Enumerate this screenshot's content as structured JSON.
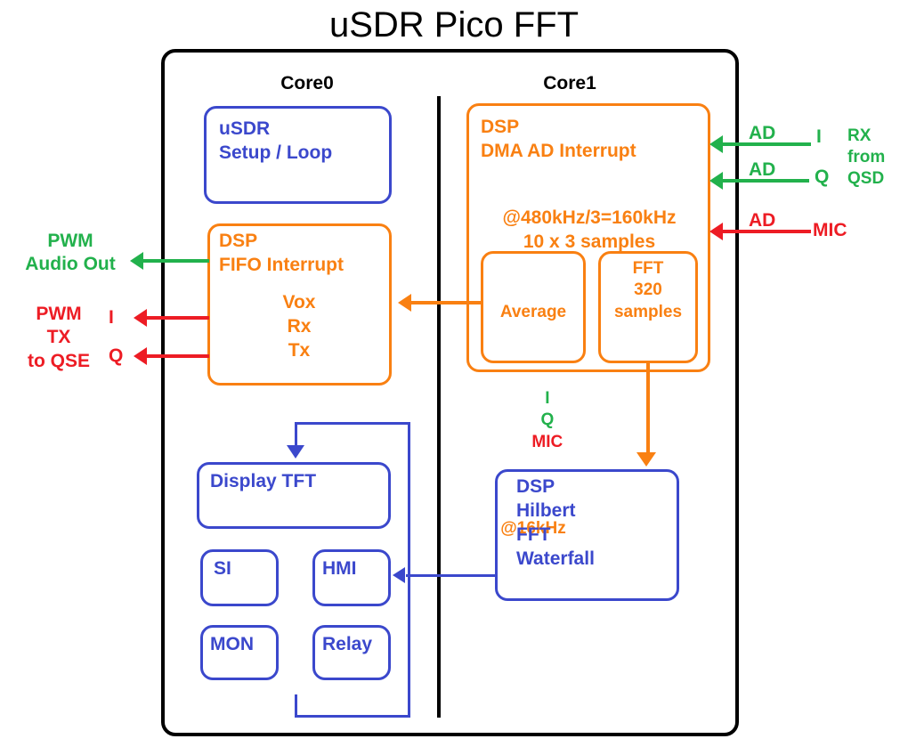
{
  "title": "uSDR Pico FFT",
  "colors": {
    "blue": "#3b48cc",
    "orange": "#f98012",
    "green": "#22b14c",
    "red": "#ed1c24",
    "black": "#000000"
  },
  "cores": {
    "core0_label": "Core0",
    "core1_label": "Core1"
  },
  "core0": {
    "usdr_box": {
      "text": "uSDR\nSetup / Loop"
    },
    "dsp_fifo_box": {
      "header": "DSP\nFIFO Interrupt",
      "items": "Vox\nRx\nTx"
    },
    "display_box": {
      "label": "Display TFT"
    },
    "si_box": {
      "label": "SI"
    },
    "hmi_box": {
      "label": "HMI"
    },
    "mon_box": {
      "label": "MON"
    },
    "relay_box": {
      "label": "Relay"
    },
    "dsp_hilbert_box": {
      "text": "DSP\nHilbert\nFFT\nWaterfall"
    }
  },
  "core1": {
    "dsp_dma_box": {
      "header": "DSP\nDMA AD Interrupt",
      "rate": "@480kHz/3=160kHz\n10 x 3 samples"
    },
    "average_box": {
      "title": "Average",
      "i": "I",
      "q": "Q",
      "mic": "MIC",
      "rate": "@16kHz"
    },
    "fft_box": {
      "text": "FFT\n320\nsamples"
    }
  },
  "io_left": {
    "pwm_audio_out": "PWM\nAudio Out",
    "pwm_tx_to_qse": "PWM\nTX\nto QSE",
    "tx_i": "I",
    "tx_q": "Q"
  },
  "io_right": {
    "ad_i": "AD",
    "ad_q": "AD",
    "ad_mic": "AD",
    "rx_i": "I",
    "rx_q": "Q",
    "mic": "MIC",
    "rx_from_qsd": "RX\nfrom\nQSD"
  }
}
